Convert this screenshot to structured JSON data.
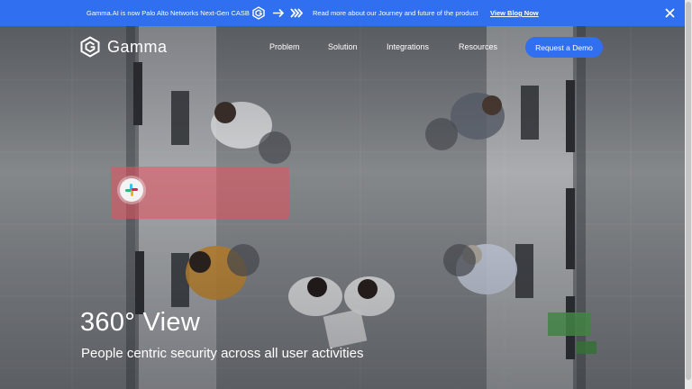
{
  "announcement": {
    "message": "Gamma.AI is now Palo Alto Networks Next-Gen CASB",
    "read_more": "Read more about our Journey and future of the product",
    "link_label": "View Blog Now"
  },
  "header": {
    "logo_text": "Gamma",
    "nav": [
      "Problem",
      "Solution",
      "Integrations",
      "Resources"
    ],
    "cta_label": "Request a Demo"
  },
  "hero": {
    "title": "360° View",
    "subtitle": "People centric security across all user activities",
    "card_icon": "slack-logo-icon"
  },
  "colors": {
    "brand_blue": "#2f6ff0",
    "card_red": "#e8505c",
    "text": "#ffffff"
  }
}
